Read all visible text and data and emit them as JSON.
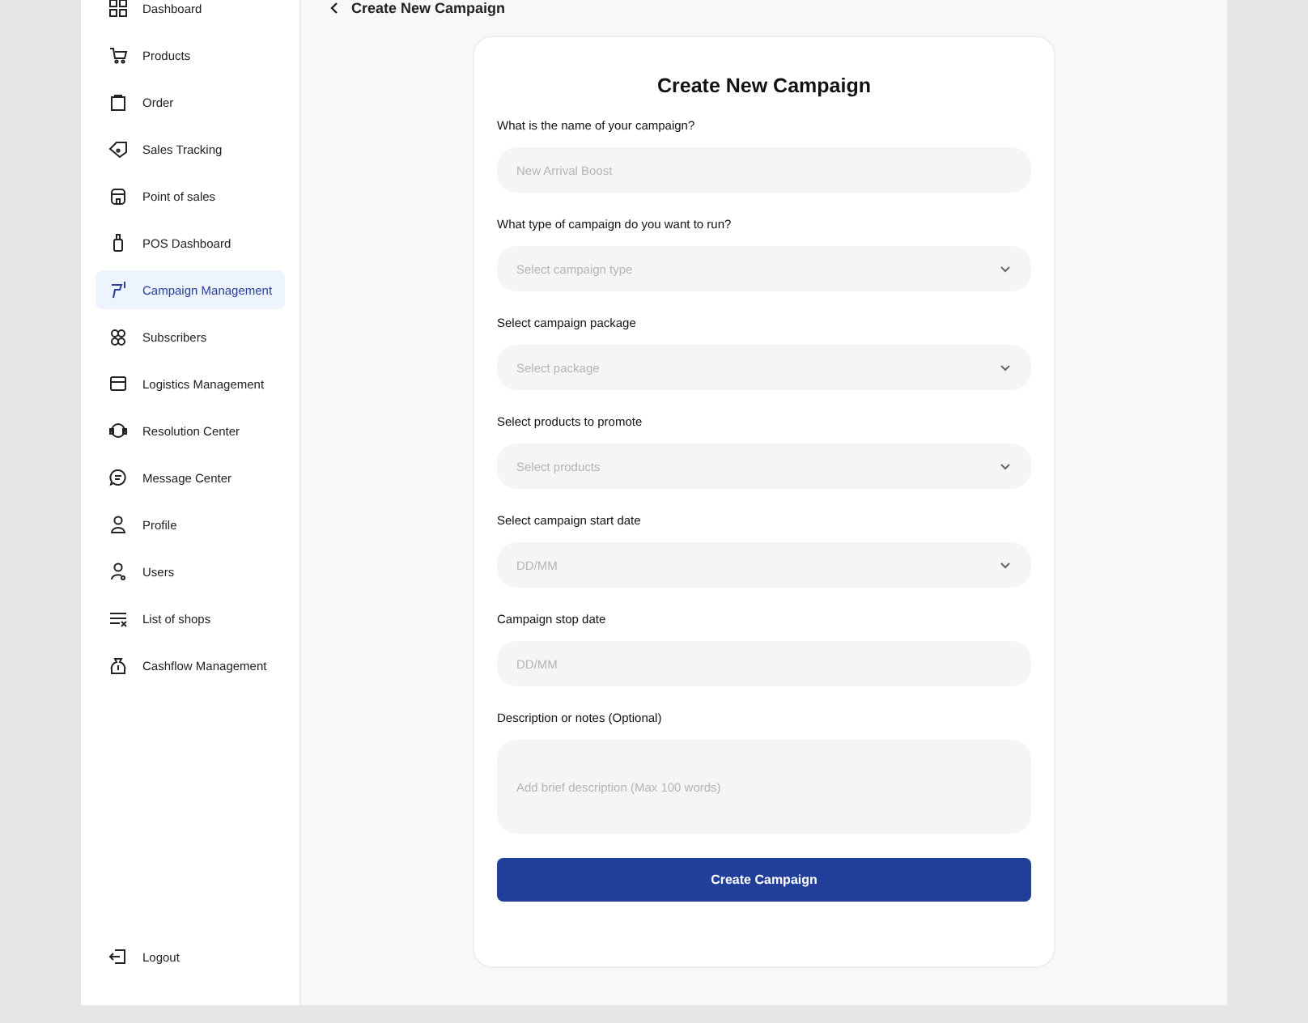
{
  "sidebar": {
    "items": [
      {
        "label": "Dashboard",
        "selected": false
      },
      {
        "label": "Products",
        "selected": false
      },
      {
        "label": "Order",
        "selected": false
      },
      {
        "label": "Sales Tracking",
        "selected": false
      },
      {
        "label": "Point of sales",
        "selected": false
      },
      {
        "label": "POS Dashboard",
        "selected": false
      },
      {
        "label": "Campaign Management",
        "selected": true
      },
      {
        "label": "Subscribers",
        "selected": false
      },
      {
        "label": "Logistics Management",
        "selected": false
      },
      {
        "label": "Resolution Center",
        "selected": false
      },
      {
        "label": "Message Center",
        "selected": false
      },
      {
        "label": "Profile",
        "selected": false
      },
      {
        "label": "Users",
        "selected": false
      },
      {
        "label": "List of shops",
        "selected": false
      },
      {
        "label": "Cashflow Management",
        "selected": false
      }
    ],
    "logout": "Logout"
  },
  "header": {
    "title": "Create New Campaign"
  },
  "form": {
    "title": "Create New Campaign",
    "fields": [
      {
        "kind": "text",
        "label": "What is the name of your campaign?",
        "placeholder": "New Arrival Boost"
      },
      {
        "kind": "select",
        "label": "What type of campaign do you want to run?",
        "placeholder": "Select campaign type"
      },
      {
        "kind": "select",
        "label": "Select campaign package",
        "placeholder": "Select package"
      },
      {
        "kind": "select",
        "label": "Select products to promote",
        "placeholder": "Select products"
      },
      {
        "kind": "select",
        "label": "Select campaign start date",
        "placeholder": "DD/MM"
      },
      {
        "kind": "text",
        "label": "Campaign stop date",
        "placeholder": "DD/MM"
      },
      {
        "kind": "textarea",
        "label": "Description or notes (Optional)",
        "placeholder": "Add brief description (Max 100 words)"
      }
    ],
    "submit": "Create Campaign"
  }
}
